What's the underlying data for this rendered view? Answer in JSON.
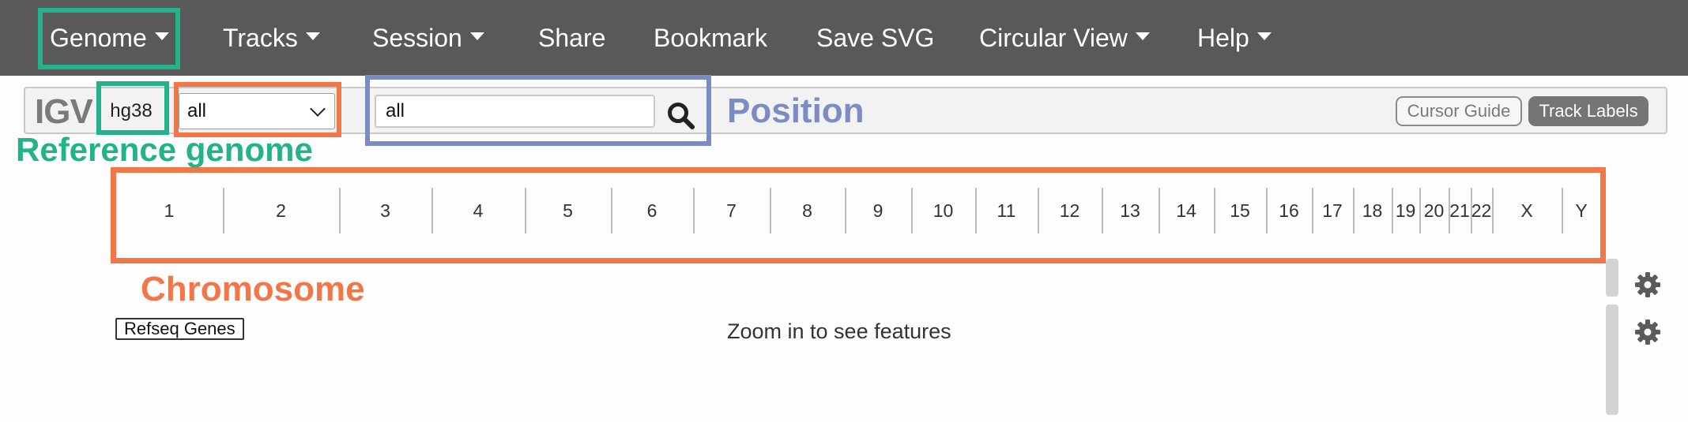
{
  "navbar": {
    "genome_label": "Genome",
    "tracks_label": "Tracks",
    "session_label": "Session",
    "share_label": "Share",
    "bookmark_label": "Bookmark",
    "save_svg_label": "Save SVG",
    "circular_view_label": "Circular View",
    "help_label": "Help"
  },
  "control_bar": {
    "logo": "IGV",
    "genome_id": "hg38",
    "chromosome_value": "all",
    "locus_value": "all",
    "cursor_guide_label": "Cursor Guide",
    "track_labels_label": "Track Labels"
  },
  "annotations": {
    "reference_genome": "Reference genome",
    "position": "Position",
    "chromosome": "Chromosome"
  },
  "ideogram": {
    "chromosomes": [
      "1",
      "2",
      "3",
      "4",
      "5",
      "6",
      "7",
      "8",
      "9",
      "10",
      "11",
      "12",
      "13",
      "14",
      "15",
      "16",
      "17",
      "18",
      "19",
      "20",
      "21",
      "22",
      "X",
      "Y"
    ]
  },
  "tracks": {
    "refseq_label": "Refseq Genes",
    "zoom_message": "Zoom in to see features"
  },
  "colors": {
    "navbar_bg": "#595959",
    "annotation_green": "#23b38a",
    "annotation_orange": "#f27748",
    "annotation_blue": "#7b8cc4"
  }
}
